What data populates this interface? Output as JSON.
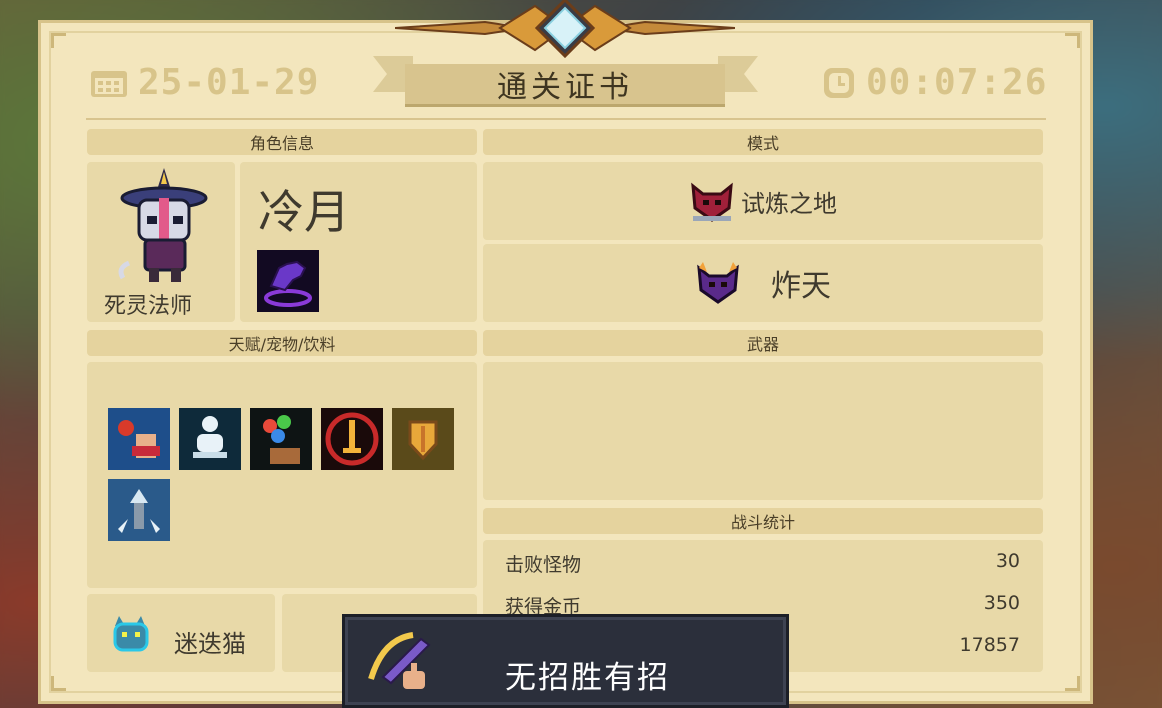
{
  "header": {
    "date": "25-01-29",
    "title": "通关证书",
    "time": "00:07:26"
  },
  "character": {
    "section_label": "角色信息",
    "name": "冷月",
    "class": "死灵法师"
  },
  "mode": {
    "section_label": "模式",
    "level": "试炼之地",
    "difficulty": "炸天"
  },
  "buffs": {
    "section_label": "天赋/宠物/饮料",
    "count": 6
  },
  "weapons": {
    "section_label": "武器"
  },
  "stats": {
    "section_label": "战斗统计",
    "rows": [
      {
        "label": "击败怪物",
        "value": "30"
      },
      {
        "label": "获得金币",
        "value": "350"
      },
      {
        "label": "",
        "value": "17857"
      }
    ]
  },
  "pet": {
    "name": "迷迭猫"
  },
  "achievement_toast": {
    "text": "无招胜有招"
  },
  "colors": {
    "paper": "#f3e6bd",
    "panel": "#e8d9a8",
    "header": "#e5d39e",
    "text": "#3f3a2e",
    "accent_gold": "#d8c48a",
    "toast_bg": "#2b2f3b"
  },
  "icons": [
    "calendar-icon",
    "clock-icon",
    "necromancer-portrait",
    "skill-hand-icon",
    "demon-mask-icon",
    "talent-icons",
    "cat-pet-icon",
    "sword-achievement-icon"
  ]
}
